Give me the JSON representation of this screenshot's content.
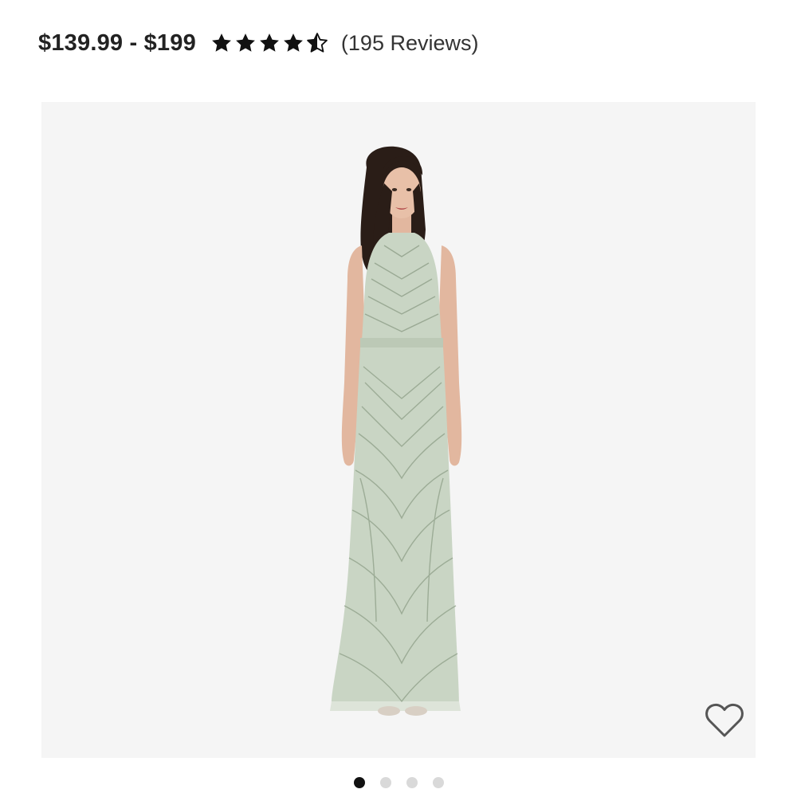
{
  "product": {
    "price_range": "$139.99 - $199",
    "rating": 4.5,
    "rating_max": 5,
    "reviews_text": "(195 Reviews)"
  },
  "gallery": {
    "image_icon": "model-in-beaded-sage-gown",
    "favorite_icon": "heart-outline-icon",
    "total_images": 4,
    "active_index": 0
  },
  "colors": {
    "text": "#222222",
    "panel_bg": "#f5f5f5",
    "dress": "#c9d5c4",
    "dot_active": "#111111",
    "dot_inactive": "#d9d9d9"
  }
}
